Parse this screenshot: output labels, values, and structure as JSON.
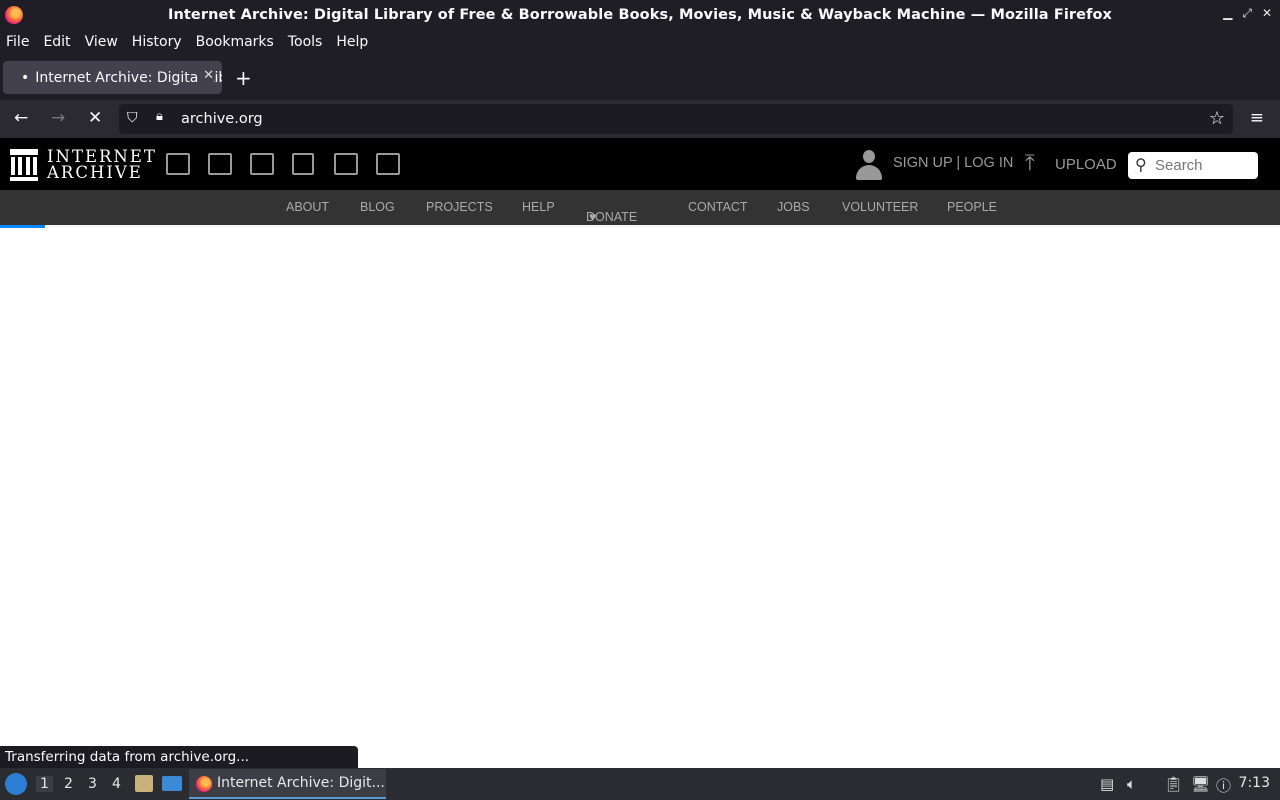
{
  "window": {
    "title": "Internet Archive: Digital Library of Free & Borrowable Books, Movies, Music & Wayback Machine — Mozilla Firefox",
    "controls": [
      "▁",
      "⤢",
      "✕"
    ]
  },
  "menu": [
    "File",
    "Edit",
    "View",
    "History",
    "Bookmarks",
    "Tools",
    "Help"
  ],
  "tab": {
    "title": "Internet Archive: Digital Library of Free & Borrowable Books",
    "loading_marker": "•"
  },
  "navbar": {
    "url": "archive.org"
  },
  "ia": {
    "wordmark_line1": "INTERNET",
    "wordmark_line2": "ARCHIVE",
    "media_icons": [
      "web-icon",
      "texts-icon",
      "video-icon",
      "audio-icon",
      "software-icon",
      "images-icon"
    ],
    "auth_label": "SIGN UP | LOG IN",
    "upload_label": "UPLOAD",
    "search_placeholder": "Search",
    "nav": [
      "ABOUT",
      "BLOG",
      "PROJECTS",
      "HELP",
      "DONATE",
      "CONTACT",
      "JOBS",
      "VOLUNTEER",
      "PEOPLE"
    ],
    "accent": "#e32222"
  },
  "status": {
    "text": "Transferring data from archive.org..."
  },
  "taskbar": {
    "workspaces": [
      "1",
      "2",
      "3",
      "4"
    ],
    "active_task": "Internet Archive: Digit...",
    "clock": "7:13"
  }
}
